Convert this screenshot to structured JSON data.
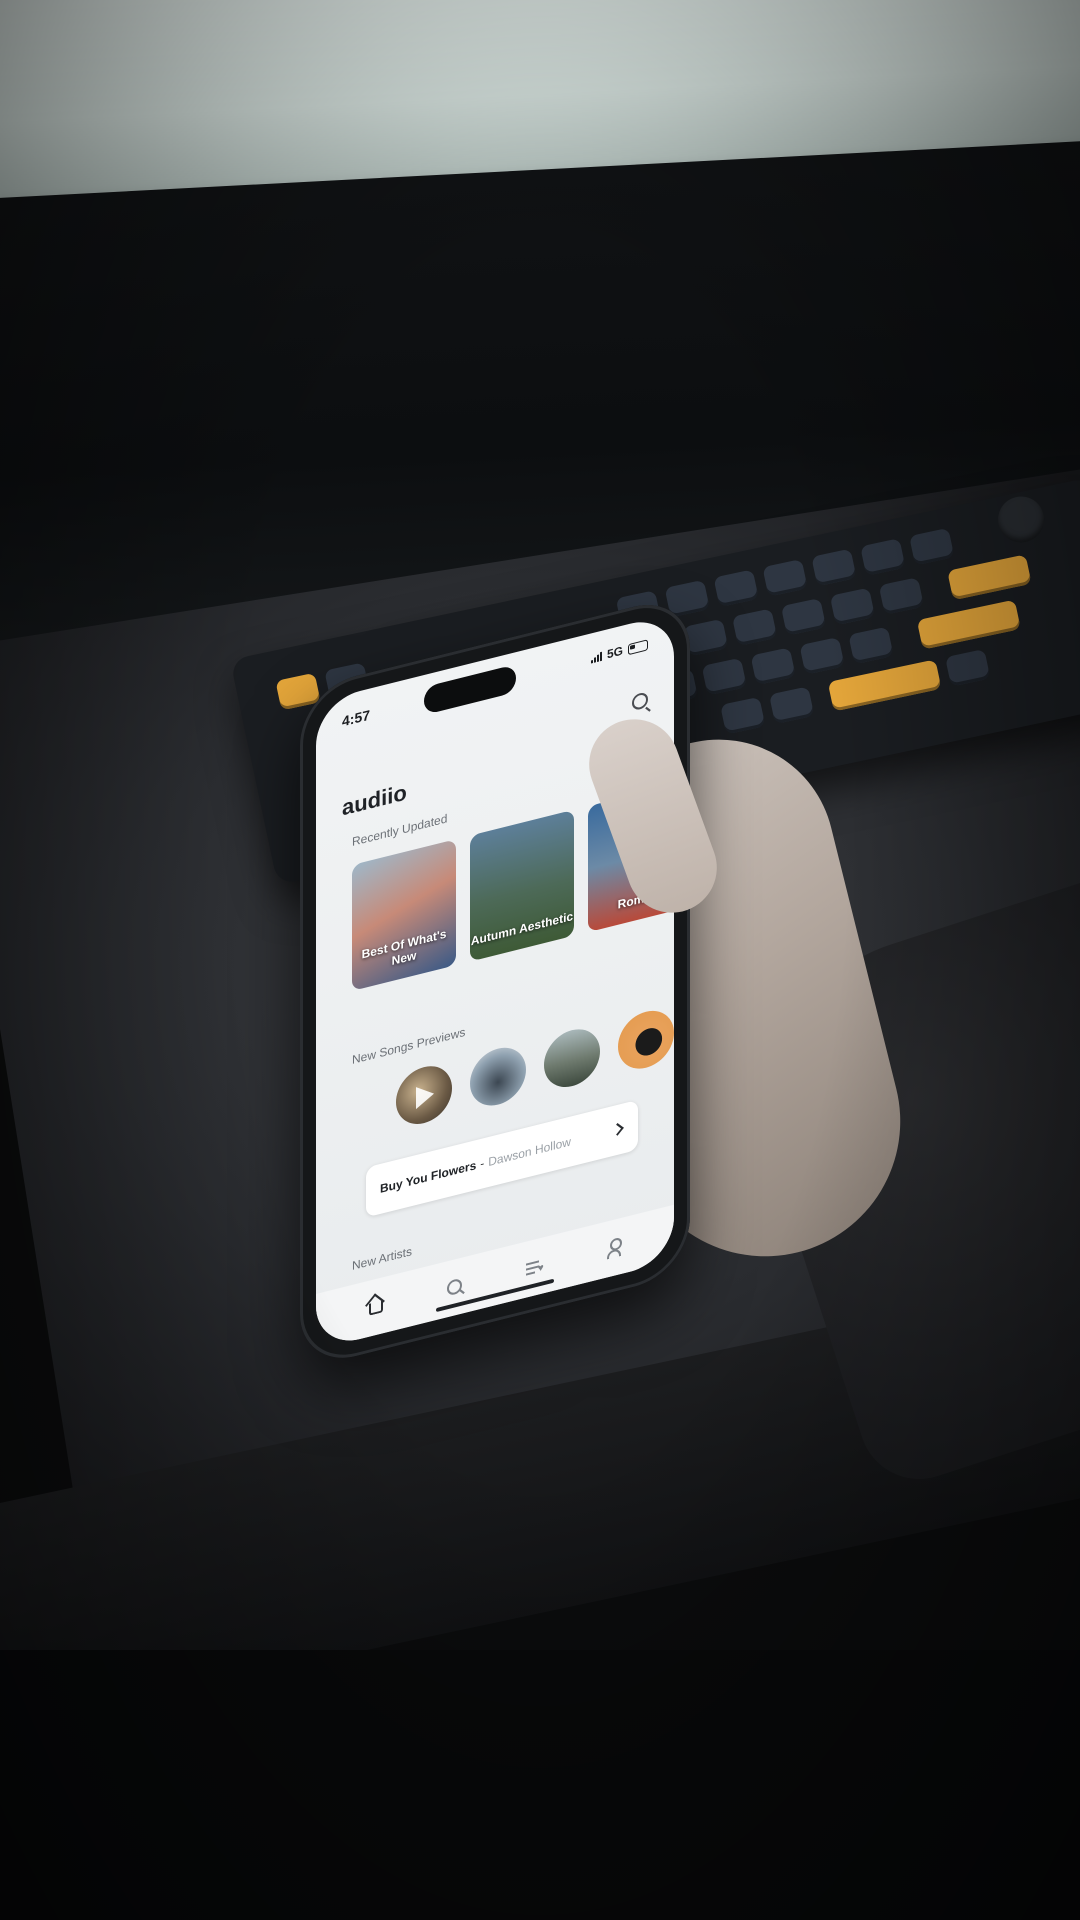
{
  "status_bar": {
    "time": "4:57",
    "network": "5G"
  },
  "app": {
    "brand": "audiio"
  },
  "recently_updated": {
    "title": "Recently Updated",
    "cards": [
      {
        "label": "Best Of What's New"
      },
      {
        "label": "Autumn Aesthetic"
      },
      {
        "label": "Romant"
      }
    ]
  },
  "new_songs": {
    "title": "New Songs Previews",
    "now_playing": {
      "song": "Buy You Flowers",
      "separator": "-",
      "artist": "Dawson Hollow"
    }
  },
  "new_artists": {
    "title": "New Artists"
  },
  "tab_bar": {
    "items": [
      "home-icon",
      "search-icon",
      "library-icon",
      "profile-icon"
    ]
  },
  "colors": {
    "key_accent": "#e3a53a",
    "screen_bg": "#f1f3f4"
  }
}
